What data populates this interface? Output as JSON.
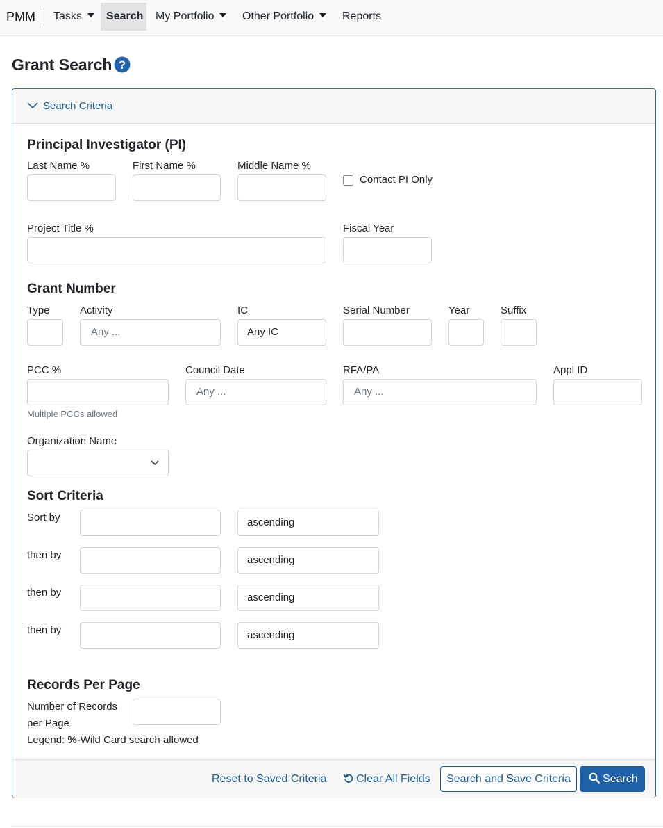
{
  "nav": {
    "brand": "PMM",
    "tasks": "Tasks",
    "search": "Search",
    "my_portfolio": "My Portfolio",
    "other_portfolio": "Other Portfolio",
    "reports": "Reports"
  },
  "page": {
    "title": "Grant Search"
  },
  "criteria_header": "Search Criteria",
  "pi": {
    "title": "Principal Investigator (PI)",
    "last_name": "Last Name %",
    "first_name": "First Name %",
    "middle_name": "Middle Name %",
    "contact_pi_only": "Contact PI Only",
    "project_title": "Project Title %",
    "fiscal_year": "Fiscal Year"
  },
  "grant": {
    "title": "Grant Number",
    "type": "Type",
    "activity": "Activity",
    "activity_placeholder": "Any ...",
    "ic": "IC",
    "ic_value": "Any IC",
    "serial_number": "Serial Number",
    "year": "Year",
    "suffix": "Suffix",
    "pcc": "PCC %",
    "pcc_help": "Multiple PCCs allowed",
    "council_date": "Council Date",
    "council_placeholder": "Any ...",
    "rfa_pa": "RFA/PA",
    "rfa_placeholder": "Any ...",
    "appl_id": "Appl ID",
    "org_name": "Organization Name"
  },
  "sort": {
    "title": "Sort Criteria",
    "sort_by": "Sort by",
    "then_by": "then by",
    "order_1": "ascending",
    "order_2": "ascending",
    "order_3": "ascending",
    "order_4": "ascending"
  },
  "records": {
    "title": "Records Per Page",
    "label": "Number of Records per Page",
    "legend_prefix": "Legend: ",
    "legend_symbol": "%",
    "legend_text": "-Wild Card search allowed"
  },
  "footer": {
    "reset": "Reset to Saved Criteria",
    "clear": "Clear All Fields",
    "search_save": "Search and Save Criteria",
    "search": "Search"
  },
  "colors": {
    "primary": "#1f61a8",
    "link": "#1c5d99"
  }
}
